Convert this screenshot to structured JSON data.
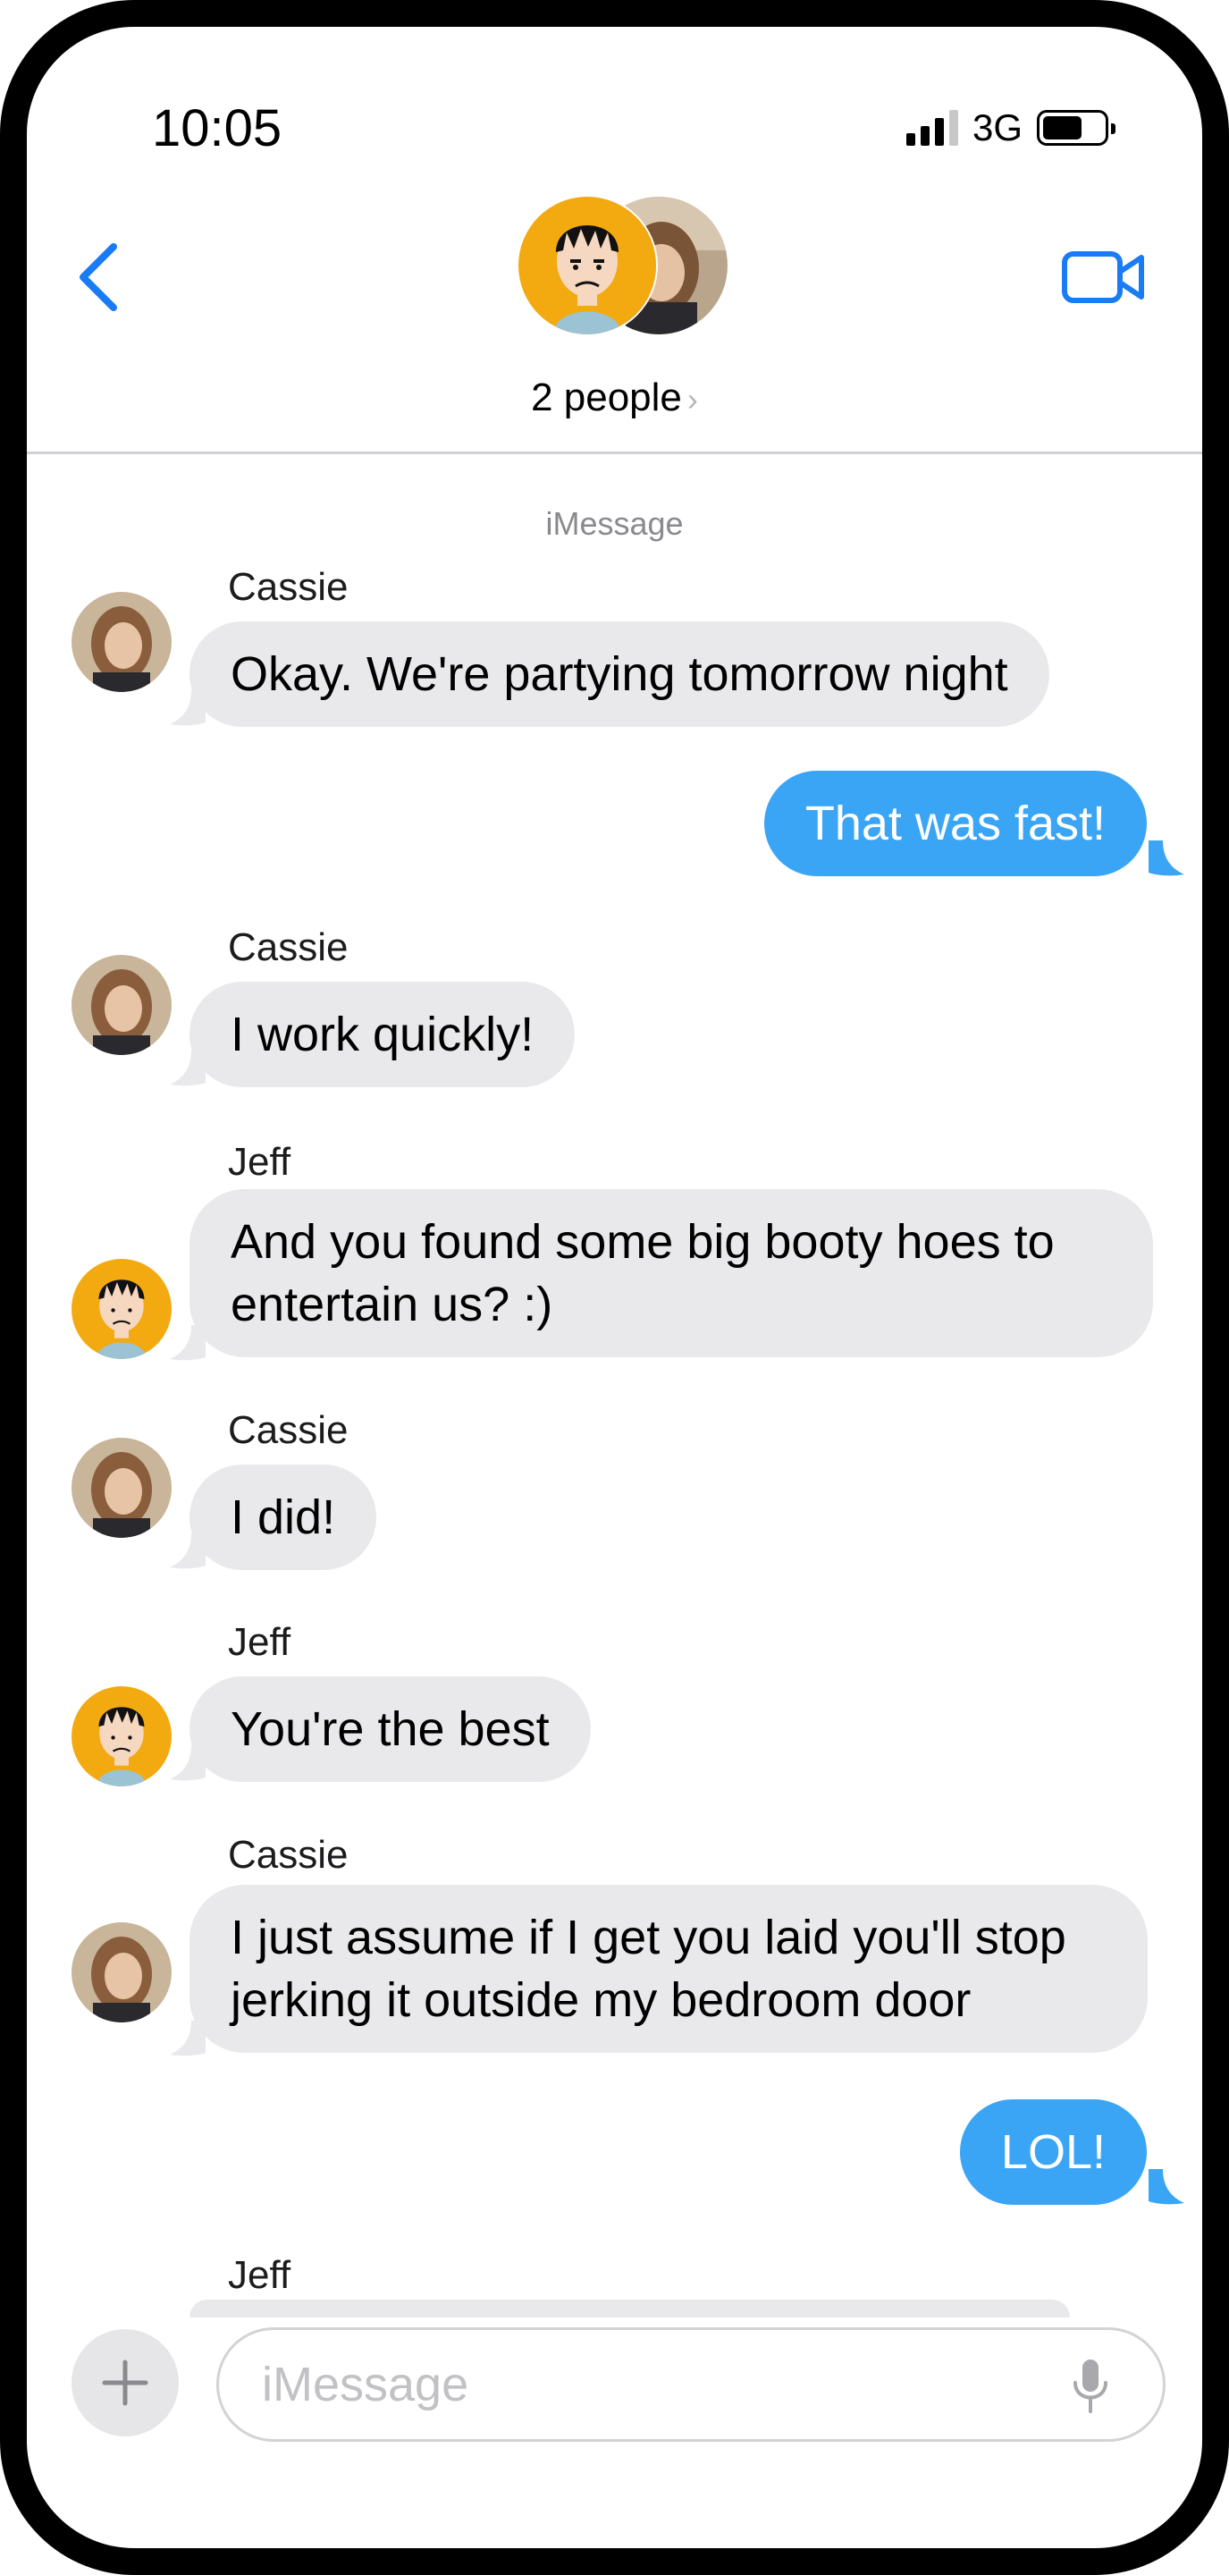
{
  "status_bar": {
    "time": "10:05",
    "network": "3G",
    "battery_level": 0.65
  },
  "header": {
    "title": "2 people",
    "chevron": "›",
    "back_icon": "chevron-left-icon",
    "video_icon": "video-camera-icon"
  },
  "thread": {
    "service_label": "iMessage"
  },
  "messages": [
    {
      "sender": "Cassie",
      "text": "Okay.  We're partying tomorrow night",
      "direction": "incoming"
    },
    {
      "sender": "",
      "text": "That was fast!",
      "direction": "outgoing"
    },
    {
      "sender": "Cassie",
      "text": "I work quickly!",
      "direction": "incoming"
    },
    {
      "sender": "Jeff",
      "lines": [
        "And you found some big booty hoes to",
        "entertain us? :)"
      ],
      "direction": "incoming"
    },
    {
      "sender": "Cassie",
      "text": "I did!",
      "direction": "incoming"
    },
    {
      "sender": "Jeff",
      "text": "You're the best",
      "direction": "incoming"
    },
    {
      "sender": "Cassie",
      "lines": [
        "I just assume if I get you laid you'll stop",
        "jerking it outside my bedroom door"
      ],
      "direction": "incoming"
    },
    {
      "sender": "",
      "text": "LOL!",
      "direction": "outgoing"
    },
    {
      "sender": "Jeff",
      "text": "",
      "direction": "incoming"
    }
  ],
  "composer": {
    "placeholder": "iMessage",
    "value": "",
    "plus_icon": "plus-icon",
    "mic_icon": "microphone-icon"
  },
  "colors": {
    "accent": "#1a7cf5",
    "outgoing_bubble": "#3ba5f5",
    "incoming_bubble": "#e9e9eb",
    "jeff_avatar_bg": "#f3aa10"
  }
}
